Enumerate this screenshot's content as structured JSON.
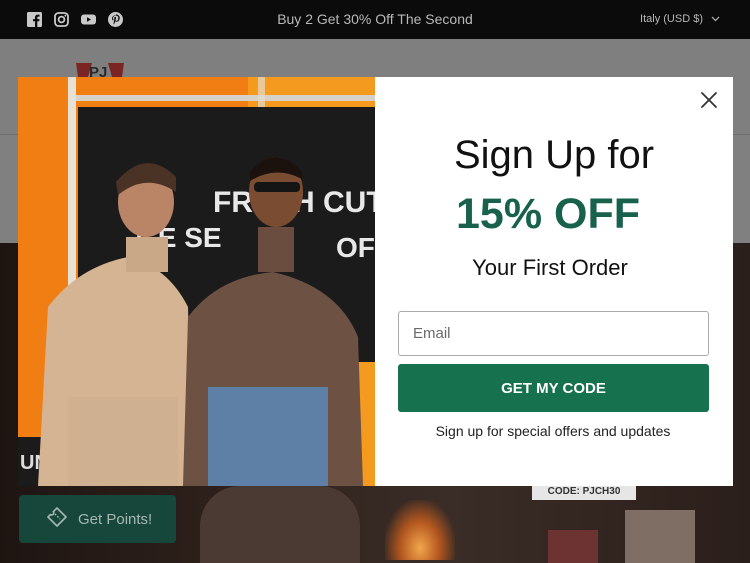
{
  "announcement": {
    "social_icons": [
      "facebook-icon",
      "instagram-icon",
      "youtube-icon",
      "pinterest-icon"
    ],
    "promo_text": "Buy 2 Get 30% Off The Second",
    "currency": "Italy (USD $)"
  },
  "background": {
    "logo_text": "PJ",
    "hero_code": "CODE: PJCH30"
  },
  "points_widget": {
    "label": "Get Points!",
    "icon": "ticket-icon"
  },
  "modal": {
    "image_sign_text": "FRESH CUT FR",
    "heading_line1": "Sign Up for",
    "heading_line2": "15% OFF",
    "heading_line3": "Your First Order",
    "email_placeholder": "Email",
    "cta_label": "GET MY CODE",
    "subtext": "Sign up for special offers and updates"
  },
  "colors": {
    "brand_green": "#17614d",
    "button_green": "#16714f",
    "topbar": "#0b0b0b"
  }
}
